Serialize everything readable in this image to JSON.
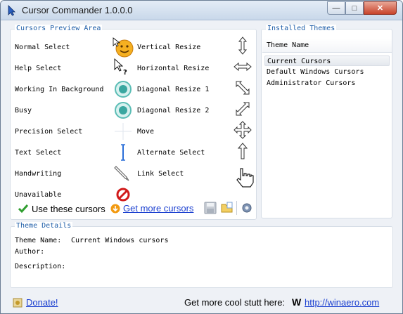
{
  "window": {
    "title": "Cursor Commander 1.0.0.0",
    "controls": {
      "minimize": "—",
      "maximize": "□",
      "close": "✕"
    }
  },
  "preview": {
    "title": "Cursors Preview Area",
    "left_items": [
      {
        "label": "Normal Select",
        "icon": "normal-select-cursor-icon"
      },
      {
        "label": "Help Select",
        "icon": "help-select-cursor-icon"
      },
      {
        "label": "Working In Background",
        "icon": "working-background-cursor-icon"
      },
      {
        "label": "Busy",
        "icon": "busy-cursor-icon"
      },
      {
        "label": "Precision Select",
        "icon": "precision-select-cursor-icon"
      },
      {
        "label": "Text Select",
        "icon": "text-select-cursor-icon"
      },
      {
        "label": "Handwriting",
        "icon": "handwriting-cursor-icon"
      },
      {
        "label": "Unavailable",
        "icon": "unavailable-cursor-icon"
      }
    ],
    "right_items": [
      {
        "label": "Vertical Resize",
        "icon": "vertical-resize-cursor-icon"
      },
      {
        "label": "Horizontal Resize",
        "icon": "horizontal-resize-cursor-icon"
      },
      {
        "label": "Diagonal Resize 1",
        "icon": "diagonal-resize-1-cursor-icon"
      },
      {
        "label": "Diagonal Resize 2",
        "icon": "diagonal-resize-2-cursor-icon"
      },
      {
        "label": "Move",
        "icon": "move-cursor-icon"
      },
      {
        "label": "Alternate Select",
        "icon": "alternate-select-cursor-icon"
      },
      {
        "label": "Link Select",
        "icon": "link-select-cursor-icon"
      }
    ],
    "use_label": "Use these cursors",
    "get_more_label": "Get more cursors"
  },
  "themes": {
    "title": "Installed Themes",
    "column": "Theme Name",
    "items": [
      "Current Cursors",
      "Default Windows Cursors",
      "Administrator Cursors"
    ],
    "selected_index": 0
  },
  "details": {
    "title": "Theme Details",
    "name_label": "Theme Name:",
    "name_value": "Current Windows cursors",
    "author_label": "Author:",
    "author_value": "",
    "description_label": "Description:",
    "description_value": ""
  },
  "footer": {
    "donate": "Donate!",
    "promo": "Get more cool stutt here:",
    "brand_letter": "W",
    "url": "http://winaero.com"
  },
  "colors": {
    "group_title": "#1f5ea8",
    "link": "#1a3fd0",
    "check": "#2f9e2f",
    "unavailable": "#d11a1a"
  }
}
